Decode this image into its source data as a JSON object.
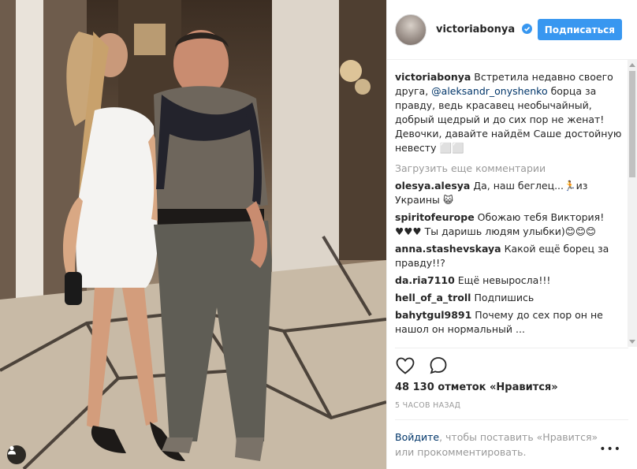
{
  "post": {
    "author": "victoriabonya",
    "follow_label": "Подписаться",
    "caption_author": "victoriabonya",
    "caption_before_mention": " Встретила недавно своего друга, ",
    "caption_mention": "@aleksandr_onyshenko",
    "caption_after_mention": " борца за правду, ведь красавец необычайный, добрый щедрый и до сих пор не женат! Девочки, давайте найдём Саше достойную невесту ⬜⬜",
    "load_more": "Загрузить еще комментарии",
    "comments": [
      {
        "user": "olesya.alesya",
        "text": " Да, наш беглец...🏃из Украины 😺"
      },
      {
        "user": "spiritofeurope",
        "text": " Обожаю тебя Виктория!♥♥♥ Ты даришь людям улыбки)😊😊😊"
      },
      {
        "user": "anna.stashevskaya",
        "text": " Какой ещё борец за правду!!?"
      },
      {
        "user": "da.ria7110",
        "text": " Ещё невыросла!!!"
      },
      {
        "user": "hell_of_a_troll",
        "text": " Подпишись"
      },
      {
        "user": "bahytgul9891",
        "text": " Почему до сех пор он не нашол он нормальный ..."
      }
    ],
    "likes": "48 130 отметок «Нравится»",
    "time": "5 часов назад",
    "login_link": "Войдите",
    "login_rest": ", чтобы поставить «Нравится» или прокомментировать.",
    "more_label": "•••"
  },
  "colors": {
    "accent": "#3897f0",
    "link": "#003569",
    "muted": "#999999"
  },
  "icons": {
    "verified": "verified-badge-icon",
    "like": "heart-icon",
    "comment": "comment-icon",
    "user_tag": "user-tag-icon",
    "more": "more-options-icon"
  }
}
